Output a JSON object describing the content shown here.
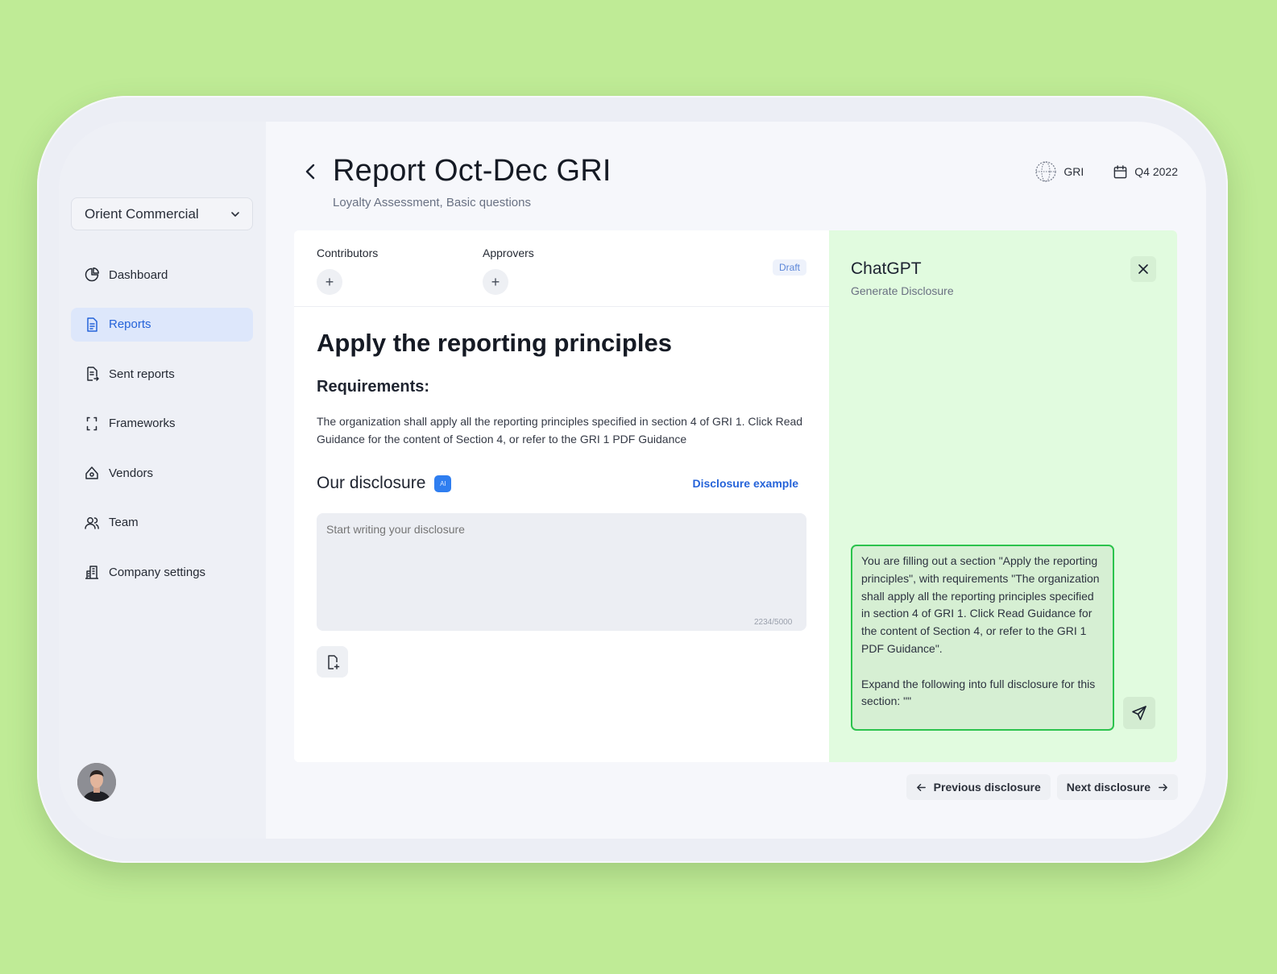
{
  "sidebar": {
    "org_select": "Orient Commercial",
    "items": [
      {
        "label": "Dashboard",
        "icon": "dashboard-pie-icon"
      },
      {
        "label": "Reports",
        "icon": "document-icon",
        "active": true
      },
      {
        "label": "Sent reports",
        "icon": "sent-report-icon"
      },
      {
        "label": "Frameworks",
        "icon": "frame-brackets-icon"
      },
      {
        "label": "Vendors",
        "icon": "vendors-icon"
      },
      {
        "label": "Team",
        "icon": "team-icon"
      },
      {
        "label": "Company settings",
        "icon": "building-icon"
      }
    ]
  },
  "header": {
    "title": "Report Oct-Dec GRI",
    "subtitle": "Loyalty Assessment, Basic questions",
    "framework": "GRI",
    "period": "Q4 2022"
  },
  "people": {
    "contributors_label": "Contributors",
    "approvers_label": "Approvers",
    "status": "Draft"
  },
  "section": {
    "title": "Apply the reporting principles",
    "requirements_label": "Requirements:",
    "requirements_text": "The organization shall apply all the reporting principles specified in section 4 of GRI 1. Click Read Guidance for the content of Section 4, or refer to the GRI 1 PDF Guidance",
    "disclosure_label": "Our disclosure",
    "ai_badge": "AI",
    "disclosure_example": "Disclosure example",
    "disclosure_placeholder": "Start writing your disclosure",
    "counter": "2234/5000"
  },
  "chatgpt": {
    "title": "ChatGPT",
    "subtitle": "Generate Disclosure",
    "prompt": "You are filling out a section \"Apply the reporting principles\", with requirements \"The organization shall apply all the reporting principles specified in section 4 of GRI 1. Click Read Guidance for the content of Section 4, or refer to the GRI 1 PDF Guidance\".\n\nExpand the following into full disclosure for this section: \"\""
  },
  "pager": {
    "previous": "Previous disclosure",
    "next": "Next disclosure"
  },
  "colors": {
    "accent": "#2563d9",
    "chat_bg": "#e1fbdf",
    "prompt_border": "#2cc34d",
    "page_bg": "#bfeb96"
  }
}
